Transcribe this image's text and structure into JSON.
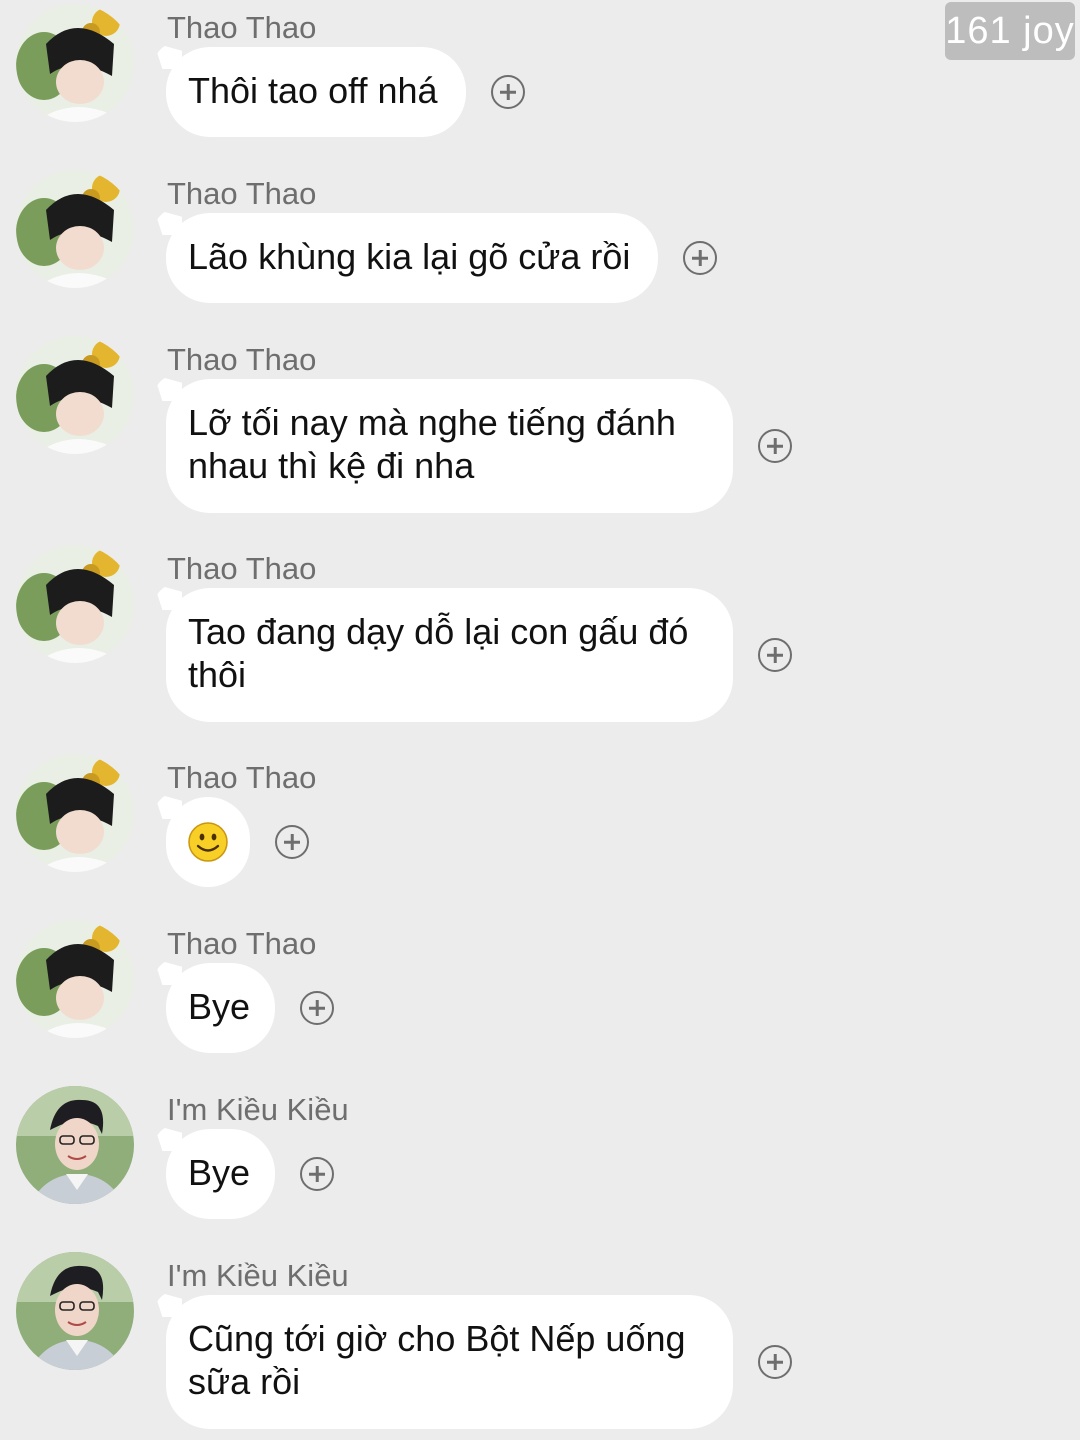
{
  "watermark": "161 joy",
  "messages": [
    {
      "sender": "Thao Thao",
      "text": "Thôi tao off nhá",
      "avatar_icon": "avatar-thao-thao"
    },
    {
      "sender": "Thao Thao",
      "text": "Lão khùng kia lại gõ cửa rồi",
      "avatar_icon": "avatar-thao-thao"
    },
    {
      "sender": "Thao Thao",
      "text": "Lỡ tối nay mà nghe tiếng đánh nhau thì kệ đi nha",
      "avatar_icon": "avatar-thao-thao"
    },
    {
      "sender": "Thao Thao",
      "text": "Tao đang dạy dỗ lại con gấu đó thôi",
      "avatar_icon": "avatar-thao-thao"
    },
    {
      "sender": "Thao Thao",
      "text": "",
      "emoji": "smiley-face-icon",
      "avatar_icon": "avatar-thao-thao"
    },
    {
      "sender": "Thao Thao",
      "text": "Bye",
      "avatar_icon": "avatar-thao-thao"
    },
    {
      "sender": "I'm Kiều Kiều",
      "text": "Bye",
      "avatar_icon": "avatar-kieu-kieu"
    },
    {
      "sender": "I'm Kiều Kiều",
      "text": "Cũng tới giờ cho Bột Nếp uống sữa rồi",
      "avatar_icon": "avatar-kieu-kieu"
    }
  ],
  "colors": {
    "background": "#ececec",
    "bubble": "#ffffff",
    "sender_text": "#6e6e6e",
    "message_text": "#111111",
    "watermark_bg": "#bdbdbd"
  }
}
